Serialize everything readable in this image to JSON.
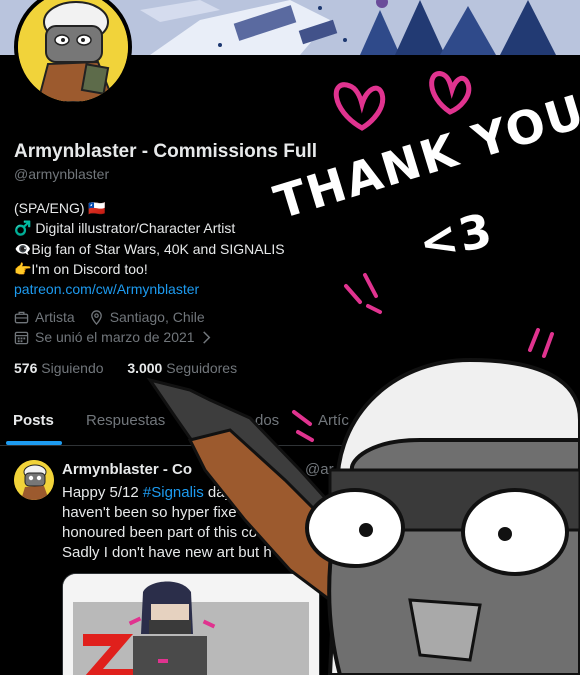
{
  "profile": {
    "name": "Armynblaster - Commissions Full",
    "handle": "@armynblaster",
    "bio": [
      "(SPA/ENG) 🇨🇱",
      "♂️ Digital illustrator/Character Artist",
      "👁‍🗨Big fan of Star Wars, 40K and SIGNALIS",
      "👉I'm on Discord too!"
    ],
    "link": "patreon.com/cw/Armynblaster",
    "category": "Artista",
    "location": "Santiago, Chile",
    "joined": "Se unió el marzo de 2021",
    "following_count": "576",
    "following_label": "Siguiendo",
    "followers_count": "3.000",
    "followers_label": "Seguidores"
  },
  "tabs": [
    {
      "label": "Posts",
      "active": true
    },
    {
      "label": "Respuestas"
    },
    {
      "label": "dos"
    },
    {
      "label": "Artíc"
    }
  ],
  "tweet": {
    "name": "Armynblaster - Co",
    "handle": "@ar",
    "line1_pre": "Happy 5/12 ",
    "hashtag": "#Signalis",
    "line1_post": " day",
    "line2": " haven't been so hyper fixe",
    "line3": "honoured been part of this co",
    "line4": "Sadly I don't have new art but h"
  },
  "overlay": {
    "text_line1": "THANK YOU",
    "text_line2": "<3"
  },
  "colors": {
    "accent": "#1d9bf0",
    "background": "#000000",
    "muted": "#71767b",
    "hearts": "#e0338f"
  }
}
